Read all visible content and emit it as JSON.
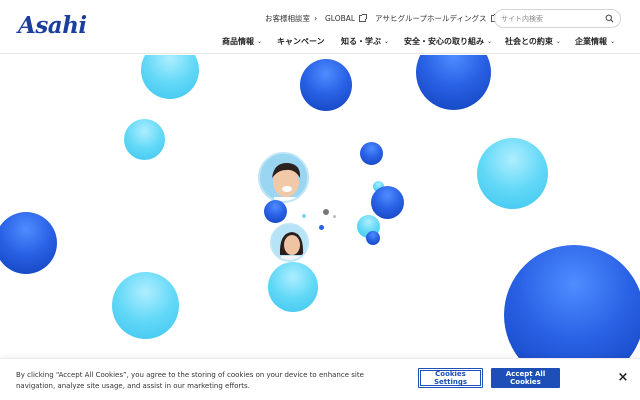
{
  "brand": {
    "logo_text": "Asahi",
    "logo_color": "#1d3f9c"
  },
  "utility_links": [
    {
      "label": "お客様相談室",
      "icon": "chevron-right-icon"
    },
    {
      "label": "GLOBAL",
      "icon": "external-link-icon"
    },
    {
      "label": "アサヒグループホールディングス",
      "icon": "external-link-icon"
    }
  ],
  "search": {
    "placeholder": "サイト内検索",
    "icon": "search-icon"
  },
  "nav": [
    {
      "label": "商品情報",
      "has_dropdown": true
    },
    {
      "label": "キャンペーン",
      "has_dropdown": false
    },
    {
      "label": "知る・学ぶ",
      "has_dropdown": true
    },
    {
      "label": "安全・安心の取り組み",
      "has_dropdown": true
    },
    {
      "label": "社会との約束",
      "has_dropdown": true
    },
    {
      "label": "企業情報",
      "has_dropdown": true
    }
  ],
  "hero": {
    "colors": {
      "blue_light": "#4f8dff",
      "blue_dark": "#0f3fb8",
      "cyan_light": "#aeeeff",
      "cyan_dark": "#3dc4ef"
    }
  },
  "cookie_banner": {
    "text": "By clicking “Accept All Cookies”, you agree to the storing of cookies on your device to enhance site navigation, analyze site usage, and assist in our marketing efforts.",
    "settings_label": "Cookies Settings",
    "accept_label": "Accept All Cookies",
    "close_label": "×",
    "accent_color": "#1e4fb8"
  }
}
